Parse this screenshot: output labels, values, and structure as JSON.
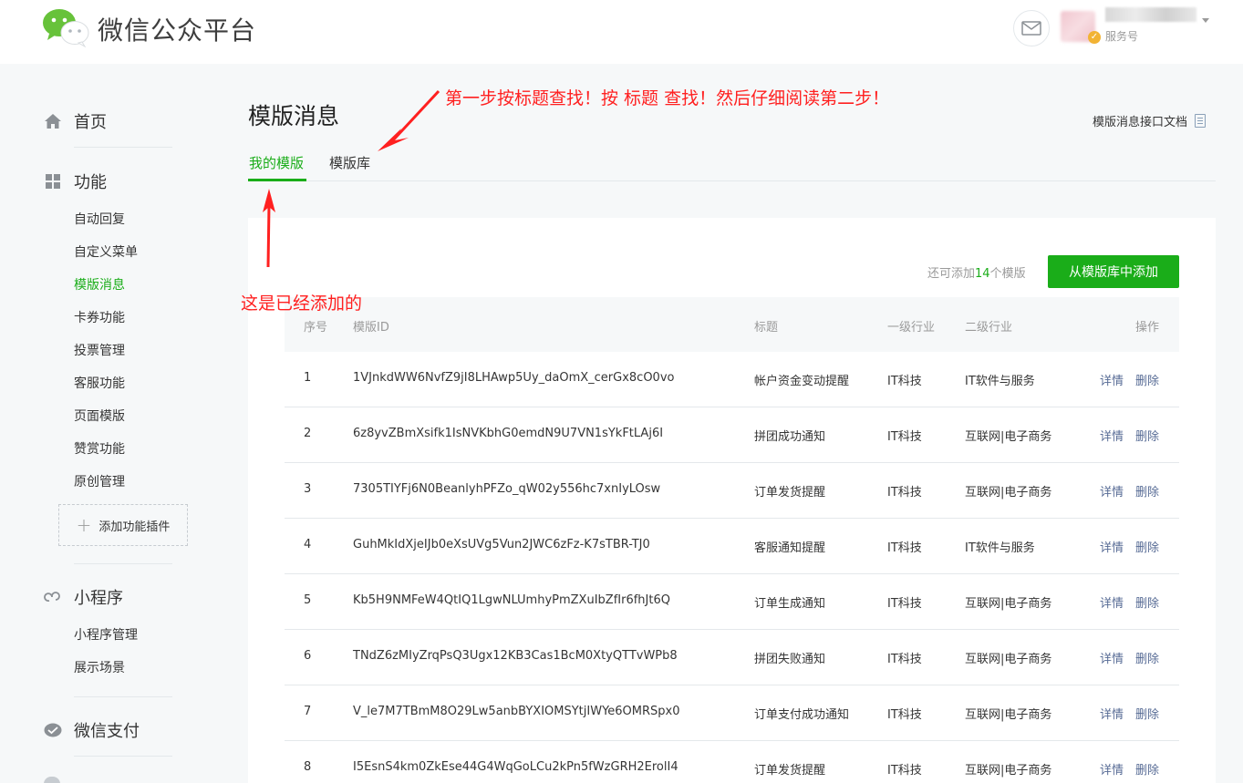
{
  "header": {
    "brand": "微信公众平台",
    "account_type": "服务号"
  },
  "sidebar": {
    "home": "首页",
    "features": "功能",
    "feature_items": [
      "自动回复",
      "自定义菜单",
      "模版消息",
      "卡券功能",
      "投票管理",
      "客服功能",
      "页面模版",
      "赞赏功能",
      "原创管理"
    ],
    "active_item": "模版消息",
    "add_plugin": "添加功能插件",
    "mini_program": "小程序",
    "mini_items": [
      "小程序管理",
      "展示场景"
    ],
    "wechat_pay": "微信支付"
  },
  "main": {
    "title": "模版消息",
    "doc_link": "模版消息接口文档",
    "tabs": [
      "我的模版",
      "模版库"
    ],
    "remain_prefix": "还可添加",
    "remain_count": "14",
    "remain_suffix": "个模版",
    "add_button": "从模版库中添加",
    "columns": [
      "序号",
      "模版ID",
      "标题",
      "一级行业",
      "二级行业",
      "操作"
    ],
    "rows": [
      {
        "no": "1",
        "id": "1VJnkdWW6NvfZ9jI8LHAwp5Uy_daOmX_cerGx8cO0vo",
        "title": "帐户资金变动提醒",
        "ind1": "IT科技",
        "ind2": "IT软件与服务"
      },
      {
        "no": "2",
        "id": "6z8yvZBmXsifk1IsNVKbhG0emdN9U7VN1sYkFtLAj6I",
        "title": "拼团成功通知",
        "ind1": "IT科技",
        "ind2": "互联网|电子商务"
      },
      {
        "no": "3",
        "id": "7305TIYFj6N0BeanlyhPFZo_qW02y556hc7xnIyLOsw",
        "title": "订单发货提醒",
        "ind1": "IT科技",
        "ind2": "互联网|电子商务"
      },
      {
        "no": "4",
        "id": "GuhMkIdXjeIJb0eXsUVg5Vun2JWC6zFz-K7sTBR-TJ0",
        "title": "客服通知提醒",
        "ind1": "IT科技",
        "ind2": "IT软件与服务"
      },
      {
        "no": "5",
        "id": "Kb5H9NMFeW4QtIQ1LgwNLUmhyPmZXuIbZfIr6fhJt6Q",
        "title": "订单生成通知",
        "ind1": "IT科技",
        "ind2": "互联网|电子商务"
      },
      {
        "no": "6",
        "id": "TNdZ6zMIyZrqPsQ3Ugx12KB3Cas1BcM0XtyQTTvWPb8",
        "title": "拼团失败通知",
        "ind1": "IT科技",
        "ind2": "互联网|电子商务"
      },
      {
        "no": "7",
        "id": "V_le7M7TBmM8O29Lw5anbBYXIOMSYtjIWYe6OMRSpx0",
        "title": "订单支付成功通知",
        "ind1": "IT科技",
        "ind2": "互联网|电子商务"
      },
      {
        "no": "8",
        "id": "I5EsnS4km0ZkEse44G4WqGoLCu2kPn5fWzGRH2ErolI4",
        "title": "订单发货提醒",
        "ind1": "IT科技",
        "ind2": "互联网|电子商务"
      }
    ],
    "op_detail": "详情",
    "op_delete": "删除"
  },
  "annotations": {
    "top": "第一步按标题查找！按  标题  查找！然后仔细阅读第二步！",
    "left": "这是已经添加的"
  },
  "colors": {
    "accent_green": "#1aad19",
    "link_blue": "#576b95",
    "annotation_red": "#ff2020"
  }
}
